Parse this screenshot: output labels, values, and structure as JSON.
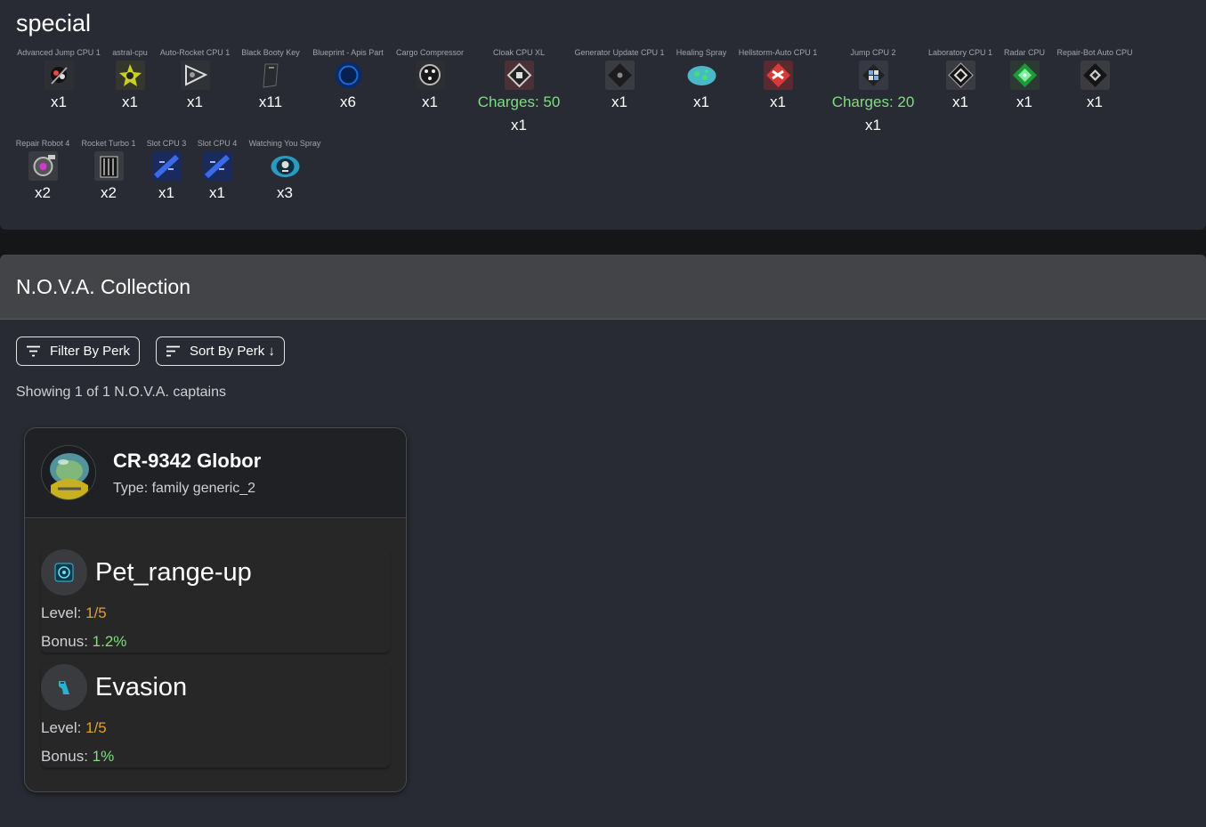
{
  "special": {
    "title": "special",
    "items": [
      {
        "name": "Advanced Jump CPU 1",
        "qty": "x1",
        "charges": null,
        "icon": "jump-cpu-icon"
      },
      {
        "name": "astral-cpu",
        "qty": "x1",
        "charges": null,
        "icon": "astral-cpu-icon"
      },
      {
        "name": "Auto-Rocket CPU 1",
        "qty": "x1",
        "charges": null,
        "icon": "auto-rocket-cpu-icon"
      },
      {
        "name": "Black Booty Key",
        "qty": "x11",
        "charges": null,
        "icon": "booty-key-icon"
      },
      {
        "name": "Blueprint - Apis Part",
        "qty": "x6",
        "charges": null,
        "icon": "blueprint-icon"
      },
      {
        "name": "Cargo Compressor",
        "qty": "x1",
        "charges": null,
        "icon": "cargo-compressor-icon"
      },
      {
        "name": "Cloak CPU XL",
        "qty": "x1",
        "charges": "Charges: 50",
        "icon": "cloak-cpu-icon"
      },
      {
        "name": "Generator Update CPU 1",
        "qty": "x1",
        "charges": null,
        "icon": "generator-cpu-icon"
      },
      {
        "name": "Healing Spray",
        "qty": "x1",
        "charges": null,
        "icon": "healing-spray-icon"
      },
      {
        "name": "Hellstorm-Auto CPU 1",
        "qty": "x1",
        "charges": null,
        "icon": "hellstorm-cpu-icon"
      },
      {
        "name": "Jump CPU 2",
        "qty": "x1",
        "charges": "Charges: 20",
        "icon": "jump-cpu-2-icon"
      },
      {
        "name": "Laboratory CPU 1",
        "qty": "x1",
        "charges": null,
        "icon": "laboratory-cpu-icon"
      },
      {
        "name": "Radar CPU",
        "qty": "x1",
        "charges": null,
        "icon": "radar-cpu-icon"
      },
      {
        "name": "Repair-Bot Auto CPU",
        "qty": "x1",
        "charges": null,
        "icon": "repair-bot-cpu-icon"
      },
      {
        "name": "Repair Robot 4",
        "qty": "x2",
        "charges": null,
        "icon": "repair-robot-icon"
      },
      {
        "name": "Rocket Turbo 1",
        "qty": "x2",
        "charges": null,
        "icon": "rocket-turbo-icon"
      },
      {
        "name": "Slot CPU 3",
        "qty": "x1",
        "charges": null,
        "icon": "slot-cpu-icon"
      },
      {
        "name": "Slot CPU 4",
        "qty": "x1",
        "charges": null,
        "icon": "slot-cpu-icon"
      },
      {
        "name": "Watching You Spray",
        "qty": "x3",
        "charges": null,
        "icon": "watching-spray-icon"
      }
    ]
  },
  "nova": {
    "title": "N.O.V.A. Collection",
    "filter_label": "Filter By Perk",
    "sort_label": "Sort By Perk ↓",
    "showing_text": "Showing 1 of 1 N.O.V.A. captains",
    "captain": {
      "name": "CR-9342 Globor",
      "type": "Type: family generic_2",
      "perks": [
        {
          "name": "Pet_range-up",
          "level_label": "Level:",
          "level": "1/5",
          "bonus_label": "Bonus:",
          "bonus": "1.2%",
          "icon": "range-target-icon"
        },
        {
          "name": "Evasion",
          "level_label": "Level:",
          "level": "1/5",
          "bonus_label": "Bonus:",
          "bonus": "1%",
          "icon": "evasion-icon"
        }
      ]
    }
  },
  "colors": {
    "panel_bg": "#282b33",
    "charges_green": "#7ddf7f",
    "level_orange": "#e0a030",
    "bonus_green": "#7ddf7f"
  }
}
